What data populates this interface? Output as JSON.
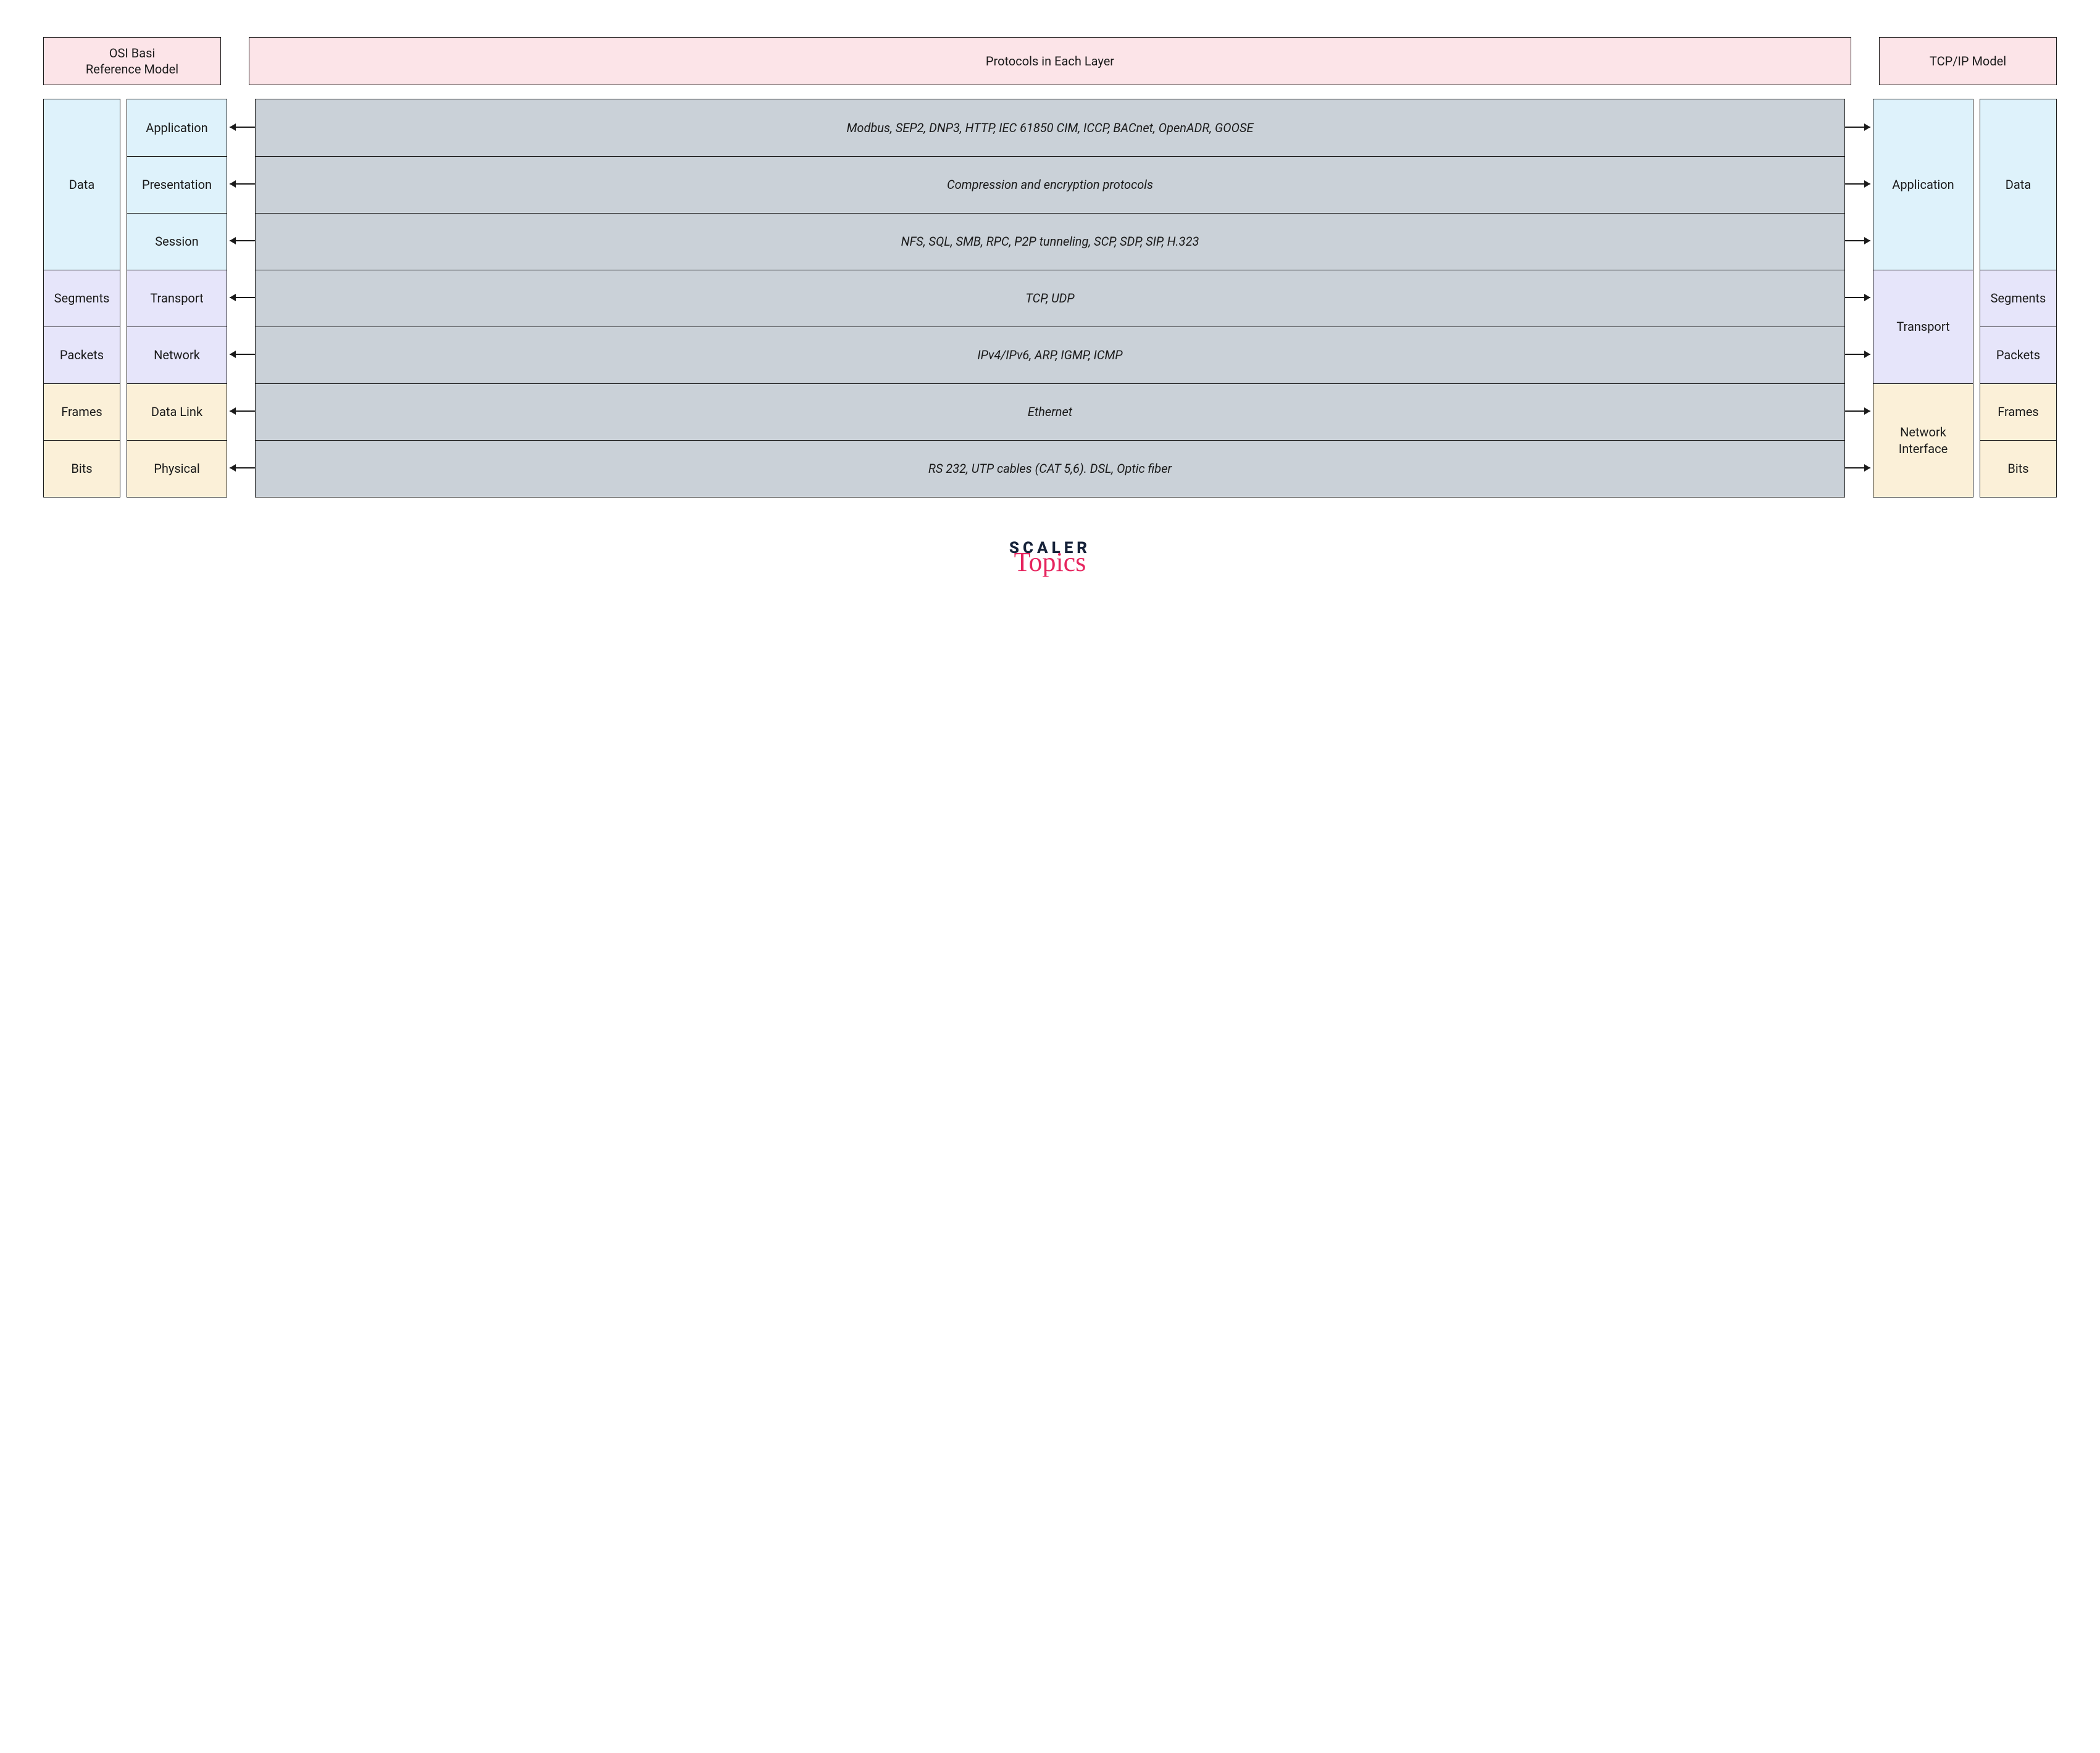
{
  "headers": {
    "osi": "OSI Basi\nReference Model",
    "protocols": "Protocols in Each Layer",
    "tcpip": "TCP/IP Model"
  },
  "osi_data_units": [
    "Data",
    "Segments",
    "Packets",
    "Frames",
    "Bits"
  ],
  "osi_layers": [
    "Application",
    "Presentation",
    "Session",
    "Transport",
    "Network",
    "Data Link",
    "Physical"
  ],
  "protocols": [
    "Modbus, SEP2, DNP3, HTTP, IEC 61850 CIM, ICCP, BACnet, OpenADR, GOOSE",
    "Compression and encryption protocols",
    "NFS, SQL, SMB, RPC, P2P tunneling, SCP, SDP, SIP, H.323",
    "TCP, UDP",
    "IPv4/IPv6, ARP, IGMP, ICMP",
    "Ethernet",
    "RS 232, UTP cables (CAT 5,6). DSL, Optic fiber"
  ],
  "tcpip_layers": [
    "Application",
    "Transport",
    "Network Interface"
  ],
  "tcpip_data_units": [
    "Data",
    "Segments",
    "Packets",
    "Frames",
    "Bits"
  ],
  "brand": {
    "top": "SCALER",
    "bottom": "Topics"
  }
}
